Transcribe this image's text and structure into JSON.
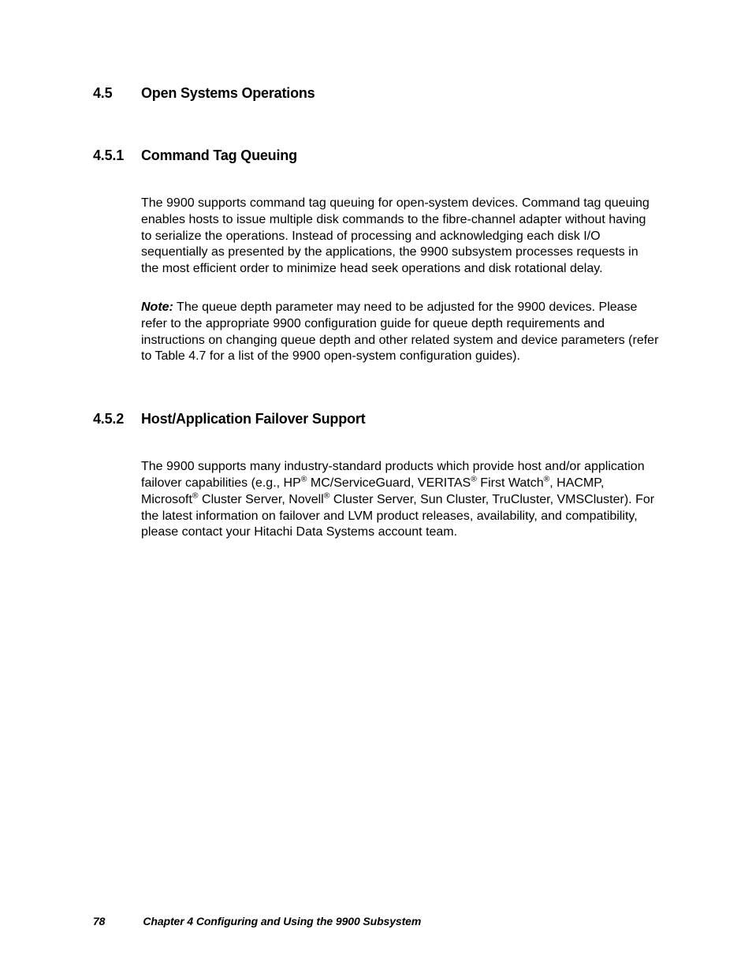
{
  "section": {
    "number": "4.5",
    "title": "Open Systems Operations"
  },
  "sub1": {
    "number": "4.5.1",
    "title": "Command Tag Queuing",
    "para1": "The 9900 supports command tag queuing for open-system devices. Command tag queuing enables hosts to issue multiple disk commands to the fibre-channel adapter without having to serialize the operations. Instead of processing and acknowledging each disk I/O sequentially as presented by the applications, the 9900 subsystem processes requests in the most efficient order to minimize head seek operations and disk rotational delay.",
    "note_label": "Note:",
    "note_text": " The queue depth parameter may need to be adjusted for the 9900 devices. Please refer to the appropriate 9900 configuration guide for queue depth requirements and instructions on changing queue depth and other related system and device parameters (refer to Table 4.7 for a list of the 9900 open-system configuration guides)."
  },
  "sub2": {
    "number": "4.5.2",
    "title": "Host/Application Failover Support",
    "p1a": "The 9900 supports many industry-standard products which provide host and/or application failover capabilities (e.g., HP",
    "reg": "®",
    "p1b": " MC/ServiceGuard, VERITAS",
    "p1c": " First Watch",
    "p1d": ", HACMP, Microsoft",
    "p1e": " Cluster Server, Novell",
    "p1f": " Cluster Server, Sun Cluster, TruCluster, VMSCluster). For the latest information on failover and LVM product releases, availability, and compatibility, please contact your Hitachi Data Systems account team."
  },
  "footer": {
    "page": "78",
    "chapter": "Chapter 4    Configuring and Using the 9900 Subsystem"
  }
}
